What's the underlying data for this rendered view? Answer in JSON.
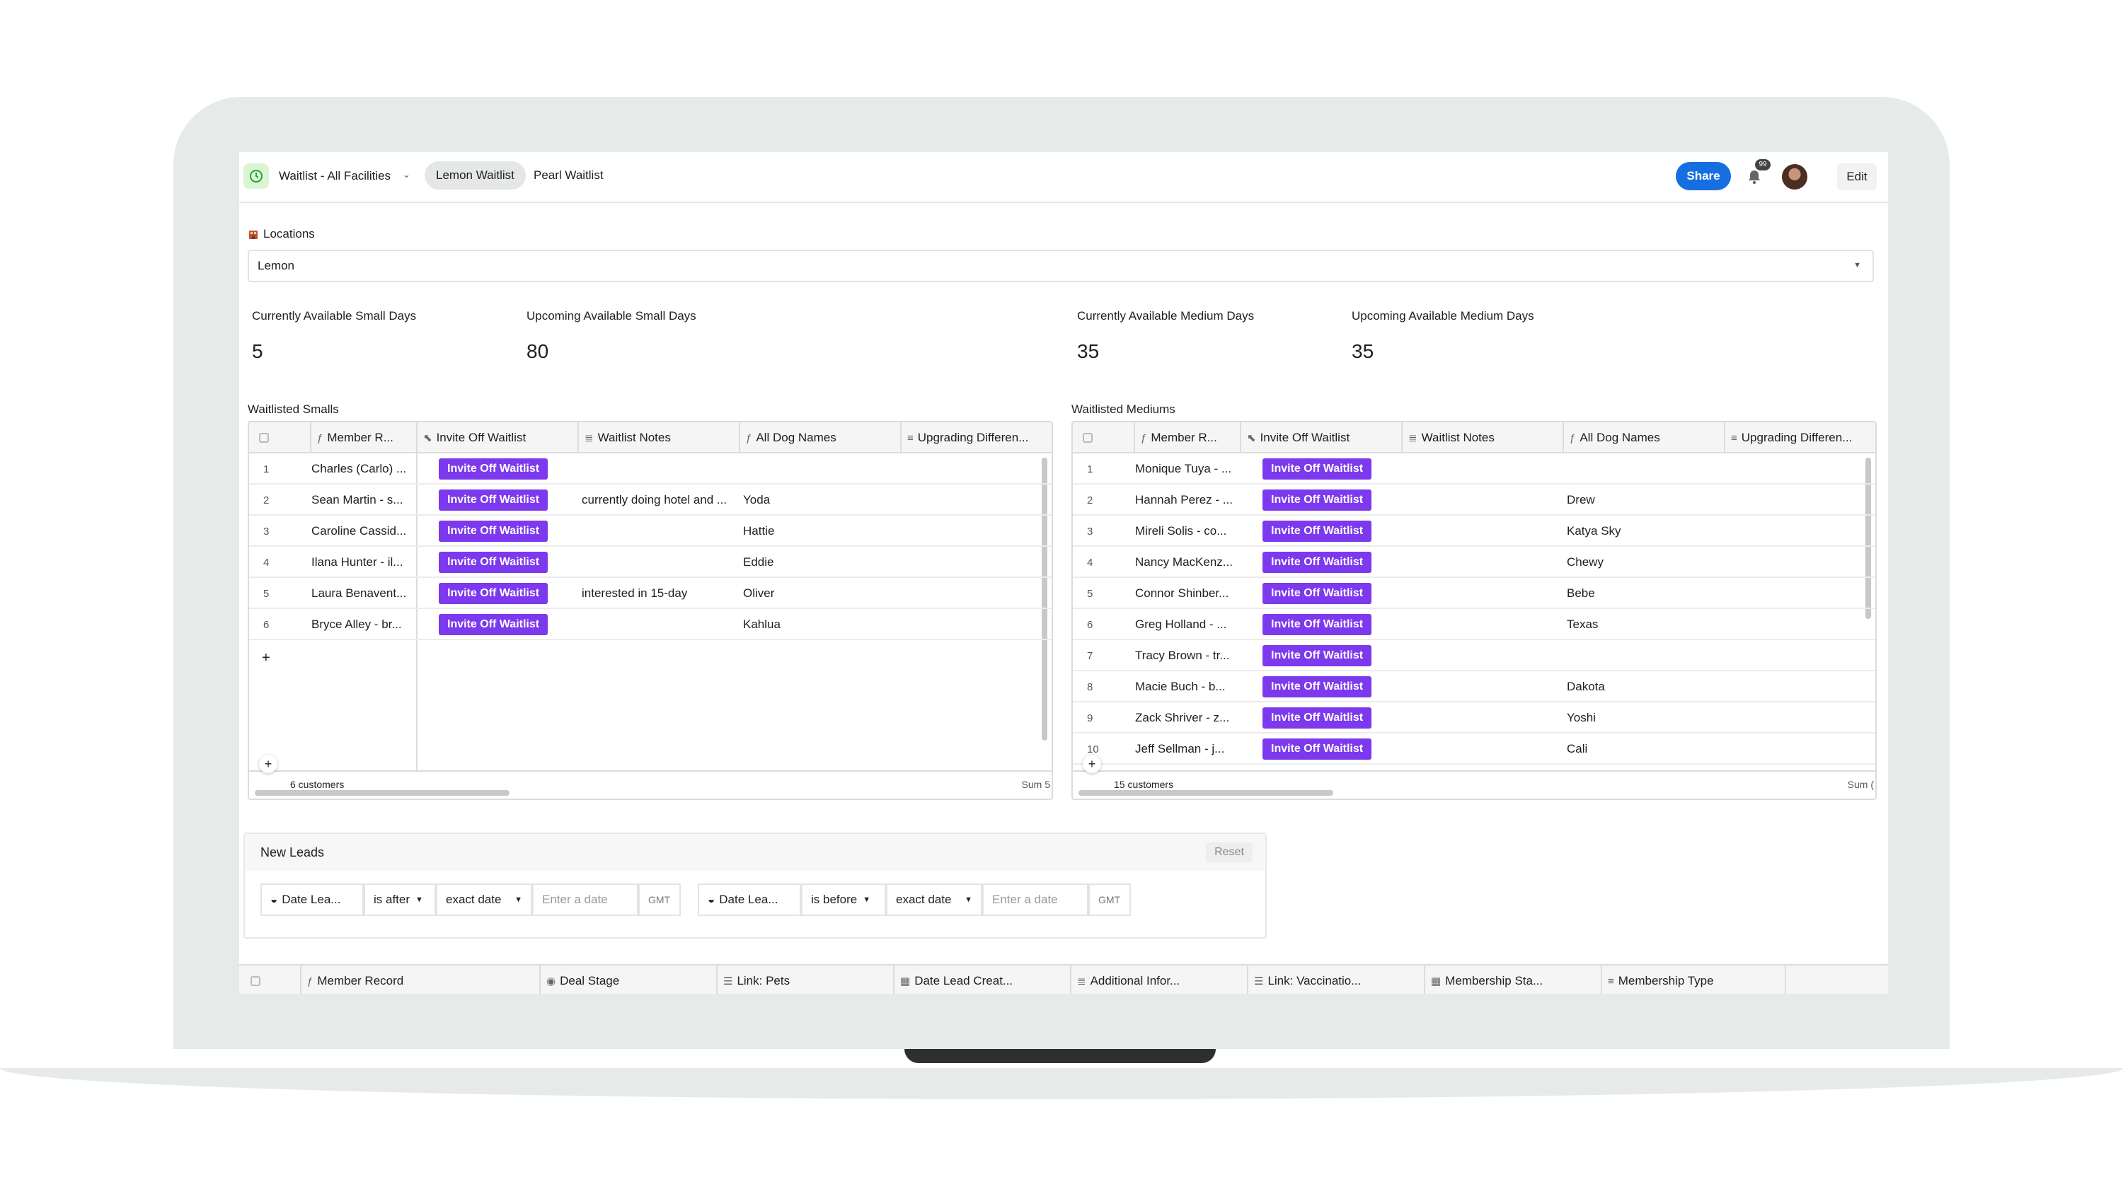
{
  "app": {
    "title": "Waitlist - All Facilities",
    "tabs": [
      "Lemon Waitlist",
      "Pearl Waitlist"
    ],
    "share_label": "Share",
    "edit_label": "Edit",
    "notification_count": "99"
  },
  "locations": {
    "label": "Locations",
    "selected": "Lemon"
  },
  "metrics": [
    {
      "label": "Currently Available Small Days",
      "value": "5"
    },
    {
      "label": "Upcoming Available Small Days",
      "value": "80"
    },
    {
      "label": "Currently Available Medium Days",
      "value": "35"
    },
    {
      "label": "Upcoming Available Medium Days",
      "value": "35"
    }
  ],
  "columns": [
    "Member R...",
    "Invite Off Waitlist",
    "Waitlist Notes",
    "All Dog Names",
    "Upgrading Differen..."
  ],
  "invite_label": "Invite Off Waitlist",
  "smalls": {
    "title": "Waitlisted Smalls",
    "count": "6 customers",
    "sum": "Sum 5",
    "rows": [
      {
        "n": "1",
        "name": "Charles (Carlo) ...",
        "notes": "",
        "dogs": ""
      },
      {
        "n": "2",
        "name": "Sean Martin - s...",
        "notes": "currently doing hotel and ...",
        "dogs": "Yoda"
      },
      {
        "n": "3",
        "name": "Caroline Cassid...",
        "notes": "",
        "dogs": "Hattie"
      },
      {
        "n": "4",
        "name": "Ilana Hunter - il...",
        "notes": "",
        "dogs": "Eddie"
      },
      {
        "n": "5",
        "name": "Laura Benavent...",
        "notes": "interested in 15-day",
        "dogs": "Oliver"
      },
      {
        "n": "6",
        "name": "Bryce Alley - br...",
        "notes": "",
        "dogs": "Kahlua"
      }
    ]
  },
  "mediums": {
    "title": "Waitlisted Mediums",
    "count": "15 customers",
    "sum": "Sum (",
    "rows": [
      {
        "n": "1",
        "name": "Monique Tuya - ...",
        "notes": "",
        "dogs": ""
      },
      {
        "n": "2",
        "name": "Hannah Perez - ...",
        "notes": "",
        "dogs": "Drew"
      },
      {
        "n": "3",
        "name": "Mireli Solis - co...",
        "notes": "",
        "dogs": "Katya Sky"
      },
      {
        "n": "4",
        "name": "Nancy MacKenz...",
        "notes": "",
        "dogs": "Chewy"
      },
      {
        "n": "5",
        "name": "Connor Shinber...",
        "notes": "",
        "dogs": "Bebe"
      },
      {
        "n": "6",
        "name": "Greg Holland - ...",
        "notes": "",
        "dogs": "Texas"
      },
      {
        "n": "7",
        "name": "Tracy Brown - tr...",
        "notes": "",
        "dogs": ""
      },
      {
        "n": "8",
        "name": "Macie Buch - b...",
        "notes": "",
        "dogs": "Dakota"
      },
      {
        "n": "9",
        "name": "Zack Shriver - z...",
        "notes": "",
        "dogs": "Yoshi"
      },
      {
        "n": "10",
        "name": "Jeff Sellman - j...",
        "notes": "",
        "dogs": "Cali"
      }
    ]
  },
  "new_leads": {
    "title": "New Leads",
    "reset_label": "Reset",
    "filters": [
      {
        "field": "Date Lea...",
        "op": "is after",
        "mode": "exact date",
        "placeholder": "Enter a date",
        "tz": "GMT"
      },
      {
        "field": "Date Lea...",
        "op": "is before",
        "mode": "exact date",
        "placeholder": "Enter a date",
        "tz": "GMT"
      }
    ]
  },
  "bottom_columns": [
    "Member Record",
    "Deal Stage",
    "Link: Pets",
    "Date Lead Creat...",
    "Additional Infor...",
    "Link: Vaccinatio...",
    "Membership Sta...",
    "Membership Type"
  ]
}
